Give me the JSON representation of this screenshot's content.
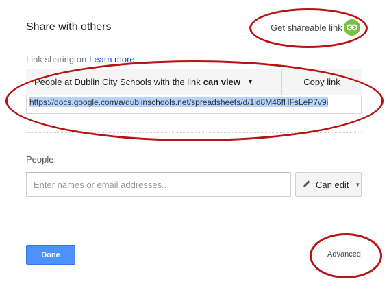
{
  "dialog": {
    "title": "Share with others",
    "get_link_label": "Get shareable link",
    "link_sharing_label": "Link sharing on",
    "learn_more": "Learn more",
    "access": {
      "prefix": "People at Dublin City Schools with the link",
      "permission": "can view"
    },
    "copy_link_label": "Copy link",
    "share_url": "https://docs.google.com/a/dublinschools.net/spreadsheets/d/1ld8M46fHFsLeP7v9i",
    "people_label": "People",
    "people_input_placeholder": "Enter names or email addresses...",
    "permission_dropdown_label": "Can edit",
    "done_label": "Done",
    "advanced_label": "Advanced"
  },
  "colors": {
    "accent_blue": "#4d90fe",
    "link_icon_green": "#7ac142",
    "annotation_red": "#b71416",
    "url_highlight": "#b5d5ff"
  },
  "icons": [
    "link-icon",
    "pencil-icon",
    "caret-down-icon"
  ]
}
